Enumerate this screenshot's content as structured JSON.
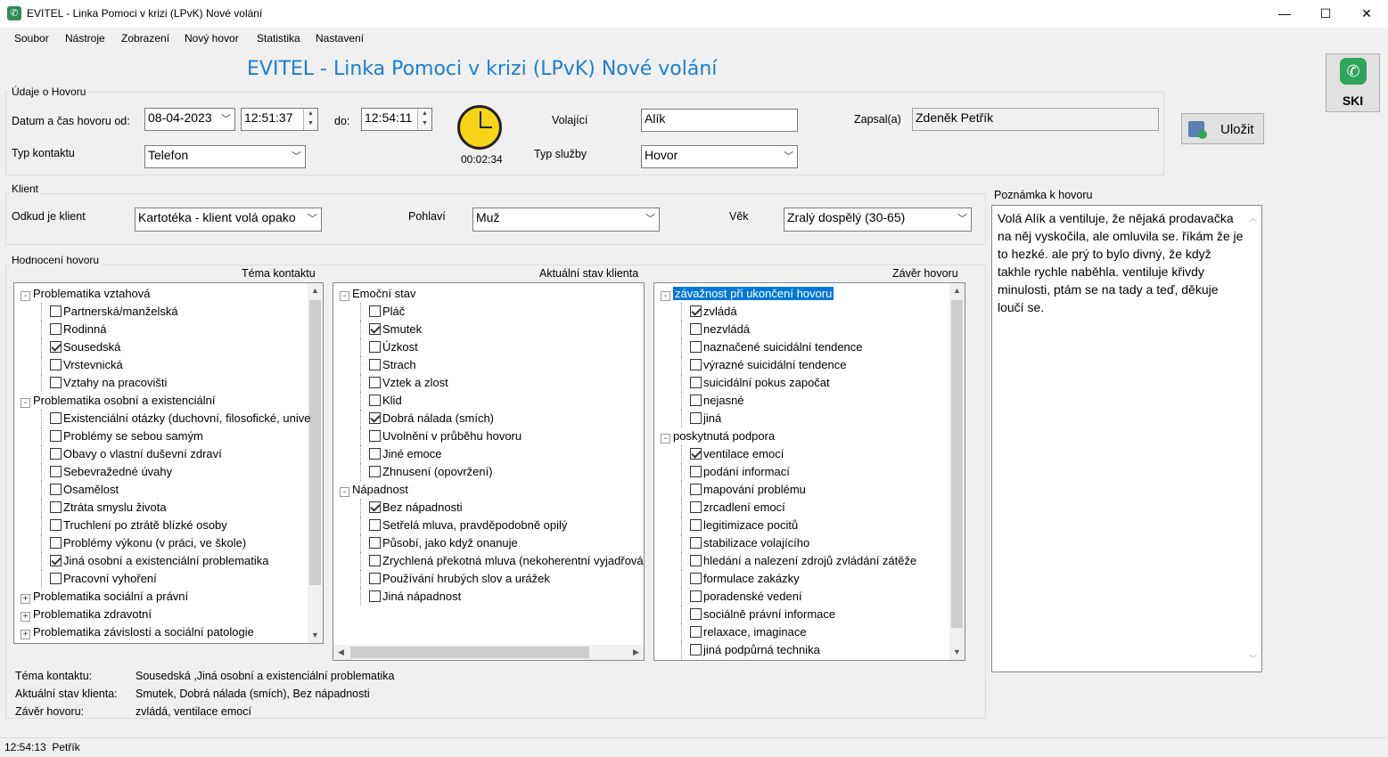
{
  "window": {
    "title": "EVITEL - Linka Pomoci v krizi (LPvK) Nové volání"
  },
  "menu": [
    "Soubor",
    "Nástroje",
    "Zobrazení",
    "Nový hovor",
    "Statistika",
    "Nastavení"
  ],
  "header": {
    "title": "EVITEL - Linka Pomoci v krizi (LPvK) Nové volání",
    "ski_label": "SKI",
    "save_label": "Uložit"
  },
  "call": {
    "group_label": "Údaje o Hovoru",
    "datetime_label": "Datum a čas hovoru od:",
    "date": "08-04-2023",
    "time_from": "12:51:37",
    "to_label": "do:",
    "time_to": "12:54:11",
    "duration": "00:02:34",
    "caller_label": "Volající",
    "caller": "Alík",
    "recorded_label": "Zapsal(a)",
    "recorded_by": "Zdeněk Petřík",
    "contact_type_label": "Typ kontaktu",
    "contact_type": "Telefon",
    "service_type_label": "Typ služby",
    "service_type": "Hovor"
  },
  "client": {
    "group_label": "Klient",
    "origin_label": "Odkud je klient",
    "origin": "Kartotéka - klient volá opako",
    "gender_label": "Pohlaví",
    "gender": "Muž",
    "age_label": "Věk",
    "age": "Zralý dospělý (30-65)"
  },
  "evaluation": {
    "group_label": "Hodnocení hovoru",
    "col1_title": "Téma kontaktu",
    "col2_title": "Aktuální stav klienta",
    "col3_title": "Závěr hovoru"
  },
  "tree1": [
    {
      "type": "node",
      "label": "Problematika vztahová",
      "exp": "-"
    },
    {
      "type": "leaf",
      "label": "Partnerská/manželská",
      "checked": false
    },
    {
      "type": "leaf",
      "label": "Rodinná",
      "checked": false
    },
    {
      "type": "leaf",
      "label": "Sousedská",
      "checked": true
    },
    {
      "type": "leaf",
      "label": "Vrstevnická",
      "checked": false
    },
    {
      "type": "leaf",
      "label": "Vztahy na pracovišti",
      "checked": false
    },
    {
      "type": "node",
      "label": "Problematika osobní a existenciální",
      "exp": "-"
    },
    {
      "type": "leaf",
      "label": "Existenciální otázky (duchovní, filosofické, unive",
      "checked": false
    },
    {
      "type": "leaf",
      "label": "Problémy se sebou samým",
      "checked": false
    },
    {
      "type": "leaf",
      "label": "Obavy o vlastní duševní zdraví",
      "checked": false
    },
    {
      "type": "leaf",
      "label": "Sebevražedné úvahy",
      "checked": false
    },
    {
      "type": "leaf",
      "label": "Osamělost",
      "checked": false
    },
    {
      "type": "leaf",
      "label": "Ztráta smyslu života",
      "checked": false
    },
    {
      "type": "leaf",
      "label": "Truchlení po ztrátě blízké osoby",
      "checked": false
    },
    {
      "type": "leaf",
      "label": "Problémy výkonu (v práci, ve škole)",
      "checked": false
    },
    {
      "type": "leaf",
      "label": "Jiná osobní a existenciální problematika",
      "checked": true
    },
    {
      "type": "leaf",
      "label": "Pracovní vyhoření",
      "checked": false
    },
    {
      "type": "node",
      "label": "Problematika sociální a právní",
      "exp": "+"
    },
    {
      "type": "node",
      "label": "Problematika zdravotní",
      "exp": "+"
    },
    {
      "type": "node",
      "label": "Problematika závislostí a sociální patologie",
      "exp": "+"
    }
  ],
  "tree2": [
    {
      "type": "node",
      "label": "Emoční stav",
      "exp": "-"
    },
    {
      "type": "leaf",
      "label": "Pláč",
      "checked": false
    },
    {
      "type": "leaf",
      "label": "Smutek",
      "checked": true
    },
    {
      "type": "leaf",
      "label": "Úzkost",
      "checked": false
    },
    {
      "type": "leaf",
      "label": "Strach",
      "checked": false
    },
    {
      "type": "leaf",
      "label": "Vztek a zlost",
      "checked": false
    },
    {
      "type": "leaf",
      "label": "Klid",
      "checked": false
    },
    {
      "type": "leaf",
      "label": "Dobrá nálada (smích)",
      "checked": true
    },
    {
      "type": "leaf",
      "label": "Uvolnění v průběhu hovoru",
      "checked": false
    },
    {
      "type": "leaf",
      "label": "Jiné emoce",
      "checked": false
    },
    {
      "type": "leaf",
      "label": "Zhnusení (opovržení)",
      "checked": false
    },
    {
      "type": "node",
      "label": "Nápadnost",
      "exp": "-"
    },
    {
      "type": "leaf",
      "label": "Bez nápadnosti",
      "checked": true
    },
    {
      "type": "leaf",
      "label": "Setřelá mluva, pravděpodobně opilý",
      "checked": false
    },
    {
      "type": "leaf",
      "label": "Působí, jako když onanuje",
      "checked": false
    },
    {
      "type": "leaf",
      "label": "Zrychlená překotná mluva (nekoherentní vyjadřová",
      "checked": false
    },
    {
      "type": "leaf",
      "label": "Používání hrubých slov a urážek",
      "checked": false
    },
    {
      "type": "leaf",
      "label": "Jiná nápadnost",
      "checked": false
    }
  ],
  "tree3": [
    {
      "type": "node",
      "label": "závažnost při ukončení hovoru",
      "exp": "-",
      "selected": true
    },
    {
      "type": "leaf",
      "label": "zvládá",
      "checked": true
    },
    {
      "type": "leaf",
      "label": "nezvládá",
      "checked": false
    },
    {
      "type": "leaf",
      "label": "naznačené suicidální tendence",
      "checked": false
    },
    {
      "type": "leaf",
      "label": "výrazné suicidální tendence",
      "checked": false
    },
    {
      "type": "leaf",
      "label": "suicidální pokus započat",
      "checked": false
    },
    {
      "type": "leaf",
      "label": "nejasné",
      "checked": false
    },
    {
      "type": "leaf",
      "label": "jiná",
      "checked": false
    },
    {
      "type": "node",
      "label": "poskytnutá podpora",
      "exp": "-"
    },
    {
      "type": "leaf",
      "label": "ventilace emocí",
      "checked": true
    },
    {
      "type": "leaf",
      "label": "podání informací",
      "checked": false
    },
    {
      "type": "leaf",
      "label": "mapování problému",
      "checked": false
    },
    {
      "type": "leaf",
      "label": "zrcadlení emocí",
      "checked": false
    },
    {
      "type": "leaf",
      "label": "legitimizace pocitů",
      "checked": false
    },
    {
      "type": "leaf",
      "label": "stabilizace volajícího",
      "checked": false
    },
    {
      "type": "leaf",
      "label": "hledání a nalezení zdrojů zvládání zátěže",
      "checked": false
    },
    {
      "type": "leaf",
      "label": "formulace zakázky",
      "checked": false
    },
    {
      "type": "leaf",
      "label": "poradenské vedení",
      "checked": false
    },
    {
      "type": "leaf",
      "label": "sociálně právní informace",
      "checked": false
    },
    {
      "type": "leaf",
      "label": "relaxace, imaginace",
      "checked": false
    },
    {
      "type": "leaf",
      "label": "jiná podpůrná technika",
      "checked": false
    }
  ],
  "note": {
    "label": "Poznámka k hovoru",
    "text": "Volá Alík a ventiluje, že nějaká prodavačka na něj vyskočila, ale omluvila se. říkám že je to hezké. ale prý to bylo divný, že když takhle rychle naběhla. ventiluje křivdy minulosti, ptám se na tady a teď, děkuje loučí se."
  },
  "summary": {
    "topic_label": "Téma kontaktu:",
    "topic": "Sousedská ,Jiná osobní a existenciální problematika",
    "state_label": "Aktuální stav klienta:",
    "state": "Smutek, Dobrá nálada (smích), Bez nápadnosti",
    "end_label": "Závěr hovoru:",
    "end": "zvládá, ventilace emocí"
  },
  "status": {
    "text": "12:54:13  Petřík"
  }
}
